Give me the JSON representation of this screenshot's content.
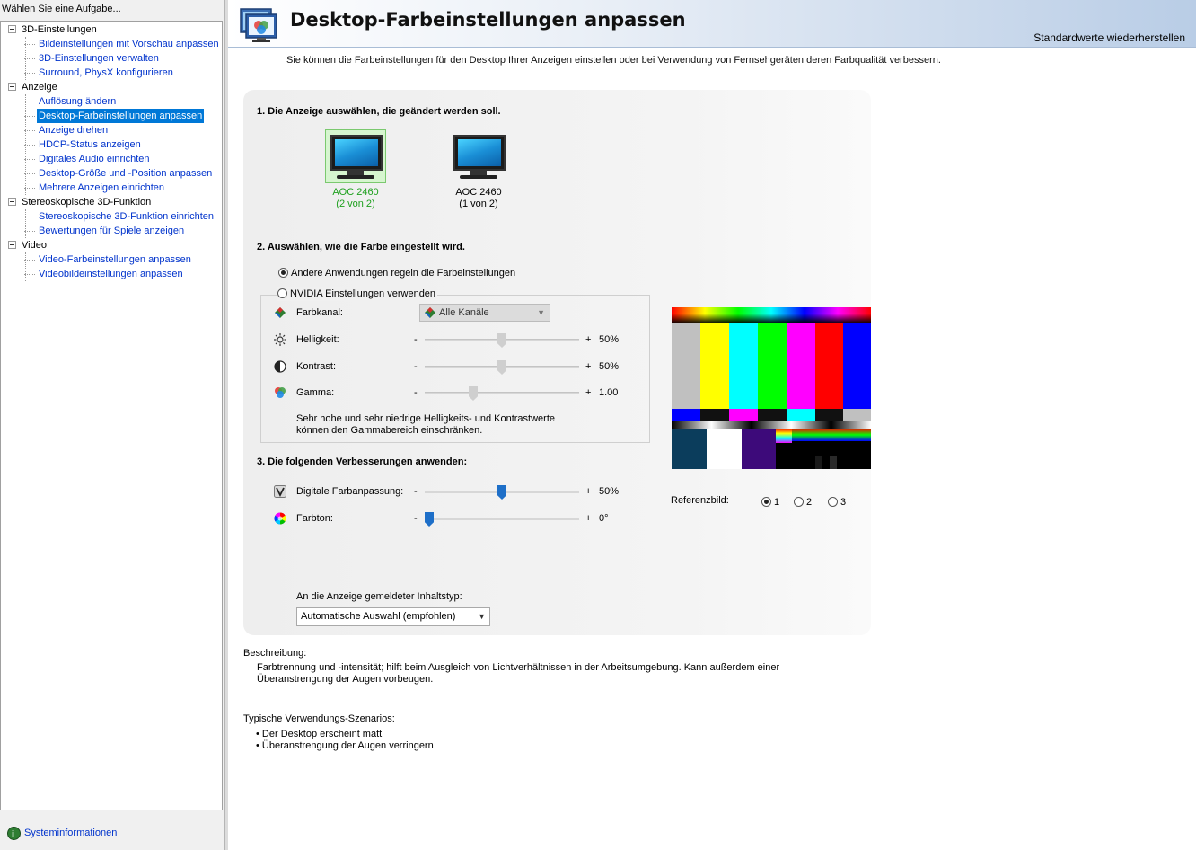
{
  "sidebar": {
    "header": "Wählen Sie eine Aufgabe...",
    "groups": [
      {
        "label": "3D-Einstellungen",
        "items": [
          {
            "label": "Bildeinstellungen mit Vorschau anpassen"
          },
          {
            "label": "3D-Einstellungen verwalten"
          },
          {
            "label": "Surround, PhysX konfigurieren"
          }
        ]
      },
      {
        "label": "Anzeige",
        "items": [
          {
            "label": "Auflösung ändern"
          },
          {
            "label": "Desktop-Farbeinstellungen anpassen",
            "selected": true
          },
          {
            "label": "Anzeige drehen"
          },
          {
            "label": "HDCP-Status anzeigen"
          },
          {
            "label": "Digitales Audio einrichten"
          },
          {
            "label": "Desktop-Größe und -Position anpassen"
          },
          {
            "label": "Mehrere Anzeigen einrichten"
          }
        ]
      },
      {
        "label": "Stereoskopische 3D-Funktion",
        "items": [
          {
            "label": "Stereoskopische 3D-Funktion einrichten"
          },
          {
            "label": "Bewertungen für Spiele anzeigen"
          }
        ]
      },
      {
        "label": "Video",
        "items": [
          {
            "label": "Video-Farbeinstellungen anpassen"
          },
          {
            "label": "Videobildeinstellungen anpassen"
          }
        ]
      }
    ],
    "system_info": "Systeminformationen"
  },
  "header": {
    "title": "Desktop-Farbeinstellungen anpassen",
    "restore_defaults": "Standardwerte wiederherstellen",
    "intro": "Sie können die Farbeinstellungen für den Desktop Ihrer Anzeigen einstellen oder bei Verwendung von Fernsehgeräten deren Farbqualität verbessern."
  },
  "step1": {
    "title": "1. Die Anzeige auswählen, die geändert werden soll.",
    "displays": [
      {
        "name": "AOC 2460",
        "sub": "(2 von 2)",
        "selected": true
      },
      {
        "name": "AOC 2460",
        "sub": "(1 von 2)",
        "selected": false
      }
    ]
  },
  "step2": {
    "title": "2. Auswählen, wie die Farbe eingestellt wird.",
    "option_other_apps": "Andere Anwendungen regeln die Farbeinstellungen",
    "option_nvidia": "NVIDIA Einstellungen verwenden",
    "selected_option": "option_other_apps",
    "channel_label": "Farbkanal:",
    "channel_value": "Alle Kanäle",
    "brightness": {
      "label": "Helligkeit:",
      "value": "50%",
      "level": 0.5
    },
    "contrast": {
      "label": "Kontrast:",
      "value": "50%",
      "level": 0.5
    },
    "gamma": {
      "label": "Gamma:",
      "value": "1.00",
      "level": 0.3
    },
    "note": "Sehr hohe und sehr niedrige Helligkeits- und Kontrastwerte können den Gammabereich einschränken."
  },
  "step3": {
    "title": "3. Die folgenden Verbesserungen anwenden:",
    "digital_vibrance": {
      "label": "Digitale Farbanpassung:",
      "value": "50%",
      "level": 0.5
    },
    "hue": {
      "label": "Farbton:",
      "value": "0°",
      "level": 0.0
    },
    "content_type_label": "An die Anzeige gemeldeter Inhaltstyp:",
    "content_type_value": "Automatische Auswahl (empfohlen)"
  },
  "slider_labels": {
    "minus": "-",
    "plus": "+"
  },
  "reference": {
    "label": "Referenzbild:",
    "options": [
      "1",
      "2",
      "3"
    ],
    "selected": "1"
  },
  "description": {
    "label": "Beschreibung:",
    "text": "Farbtrennung und -intensität; hilft beim Ausgleich von Lichtverhältnissen in der Arbeitsumgebung. Kann außerdem einer Überanstrengung der Augen vorbeugen."
  },
  "usage": {
    "label": "Typische Verwendungs-Szenarios:",
    "items": [
      "Der Desktop erscheint matt",
      "Überanstrengung der Augen verringern"
    ]
  },
  "colors": {
    "selection": "#0078d7",
    "link": "#0033cc",
    "selected_display_label": "#1ea01e",
    "slider_active": "#1e6fc8"
  }
}
